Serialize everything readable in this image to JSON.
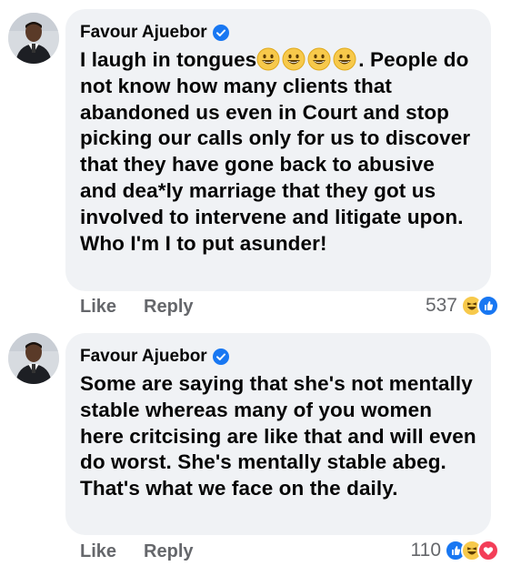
{
  "comments": [
    {
      "author": "Favour Ajuebor",
      "text_before_emoji": "I laugh in tongues",
      "emoji_count": 4,
      "text_after_emoji": ". People do not know how many clients that abandoned us even in Court and stop picking our calls only for us to discover that they have gone back to abusive and dea*ly marriage that they got us involved to intervene and litigate upon. Who I'm I to put asunder!",
      "like_label": "Like",
      "reply_label": "Reply",
      "reaction_count": "537",
      "reactions": [
        "haha",
        "like"
      ]
    },
    {
      "author": "Favour Ajuebor",
      "text": "Some are saying that she's not mentally stable whereas many of you women here critcising are like that and will even do worst. She's mentally stable abeg. That's what we face on the daily.",
      "like_label": "Like",
      "reply_label": "Reply",
      "reaction_count": "110",
      "reactions": [
        "like",
        "haha",
        "love"
      ]
    }
  ],
  "colors": {
    "bubble": "#f0f2f5",
    "like_blue": "#1877f2",
    "haha_yellow": "#f7c94b",
    "love_red": "#f33e58",
    "meta_gray": "#65676b"
  },
  "icons": {
    "verified": "verified-badge-icon",
    "emoji": "grinning-face-icon"
  }
}
